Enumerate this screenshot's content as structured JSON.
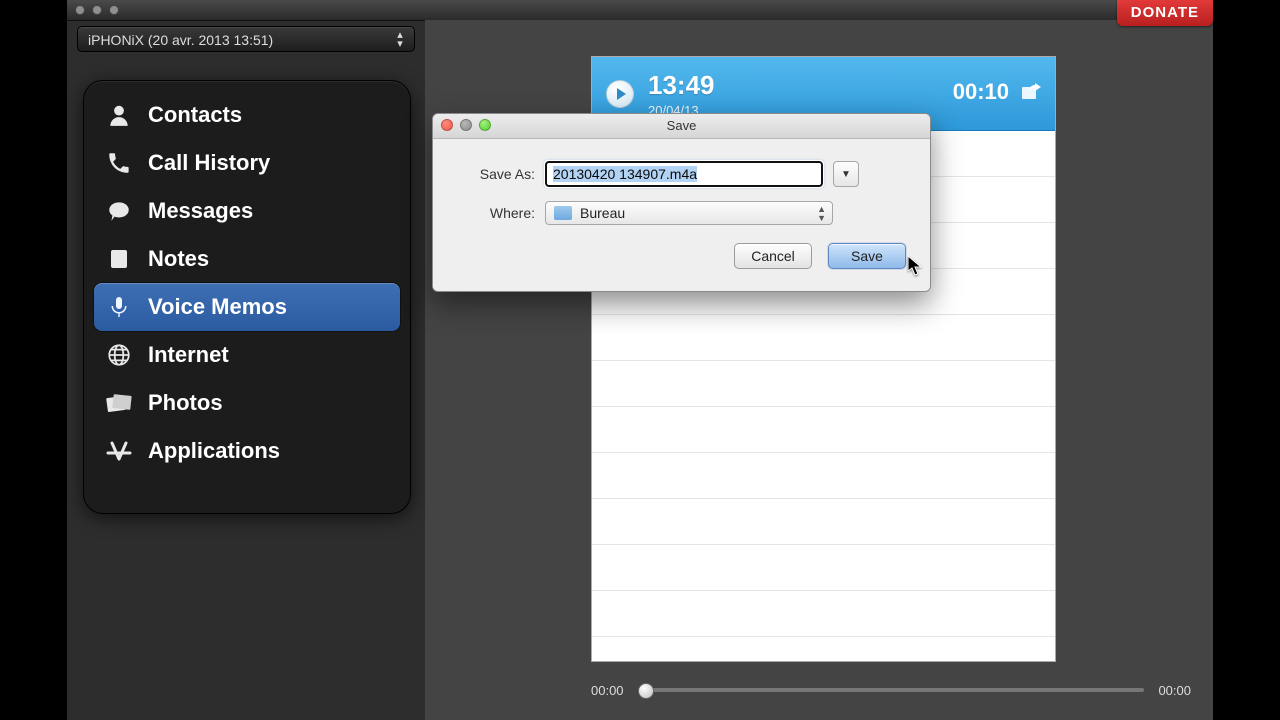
{
  "window": {
    "device_dropdown": "iPHONiX (20 avr. 2013 13:51)"
  },
  "donate": {
    "label": "DONATE"
  },
  "sidebar": {
    "items": [
      {
        "label": "Contacts",
        "icon": "user-icon"
      },
      {
        "label": "Call History",
        "icon": "phone-icon"
      },
      {
        "label": "Messages",
        "icon": "chat-icon"
      },
      {
        "label": "Notes",
        "icon": "note-icon"
      },
      {
        "label": "Voice Memos",
        "icon": "mic-icon",
        "selected": true
      },
      {
        "label": "Internet",
        "icon": "globe-icon"
      },
      {
        "label": "Photos",
        "icon": "photos-icon"
      },
      {
        "label": "Applications",
        "icon": "apps-icon"
      }
    ]
  },
  "memo": {
    "title": "13:49",
    "date": "20/04/13",
    "duration": "00:10"
  },
  "playbar": {
    "elapsed": "00:00",
    "total": "00:00"
  },
  "save_dialog": {
    "title": "Save",
    "save_as_label": "Save As:",
    "where_label": "Where:",
    "filename": "20130420 134907.m4a",
    "where_value": "Bureau",
    "cancel_label": "Cancel",
    "save_label": "Save"
  }
}
